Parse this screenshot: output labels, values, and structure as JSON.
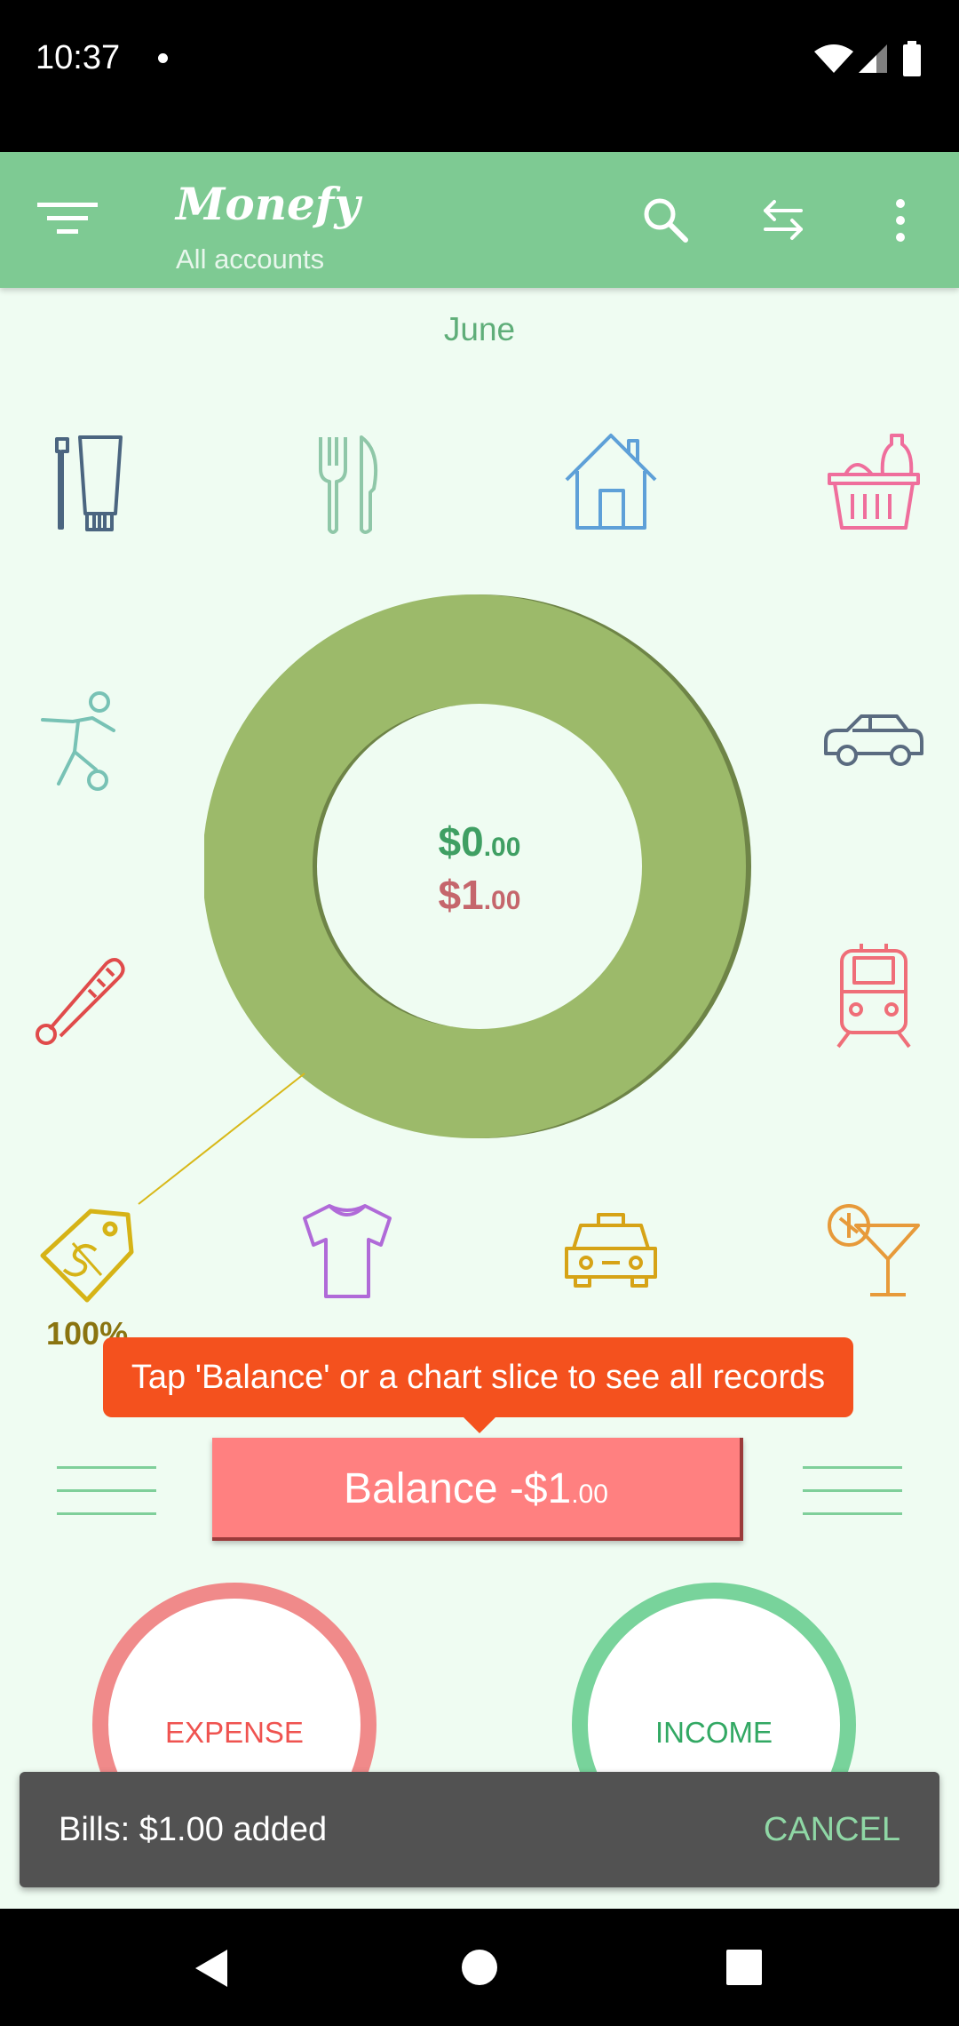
{
  "status_bar": {
    "time": "10:37"
  },
  "app_bar": {
    "title": "Monefy",
    "subtitle": "All accounts",
    "icons": [
      "filter-menu-icon",
      "search-icon",
      "transfer-icon",
      "more-vert-icon"
    ]
  },
  "month": "June",
  "categories": [
    "toiletry-icon",
    "eating-out-icon",
    "house-icon",
    "groceries-icon",
    "sports-icon",
    "car-icon",
    "health-icon",
    "transport-icon",
    "bills-icon",
    "clothes-icon",
    "taxi-icon",
    "entertainment-icon"
  ],
  "chart_data": {
    "type": "pie",
    "slices": [
      {
        "label": "Bills",
        "value": 100,
        "percent_label": "100%",
        "color": "#9cba6a"
      }
    ]
  },
  "summary": {
    "income_main": "$0",
    "income_cents": ".00",
    "expense_main": "$1",
    "expense_cents": ".00"
  },
  "tooltip": "Tap 'Balance' or a chart slice to see all records",
  "balance": {
    "main": "Balance -$1",
    "cents": ".00"
  },
  "buttons": {
    "expense": "EXPENSE",
    "income": "INCOME"
  },
  "snackbar": {
    "message": "Bills: $1.00 added",
    "action": "CANCEL"
  },
  "colors": {
    "app_bar": "#7eca93",
    "background": "#effcf2",
    "balance": "#ff8080",
    "tooltip": "#f4511e"
  }
}
